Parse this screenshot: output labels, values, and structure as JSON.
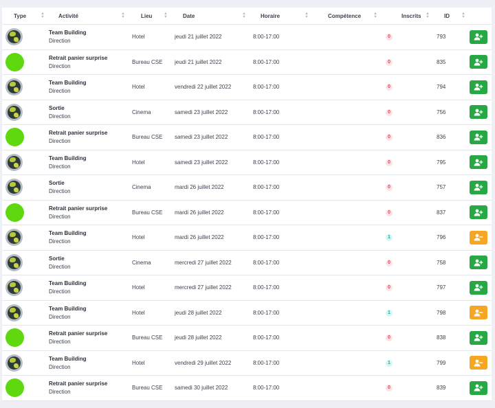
{
  "headers": {
    "type": "Type",
    "activite": "Activité",
    "lieu": "Lieu",
    "date": "Date",
    "horaire": "Horaire",
    "competence": "Compétence",
    "inscrits": "Inscrits",
    "id": "ID"
  },
  "colors": {
    "add_button": "#28a745",
    "remove_button": "#f5a623",
    "dot": "#5fd80f"
  },
  "rows": [
    {
      "type": "globe",
      "title": "Team Building",
      "sub": "Direction",
      "lieu": "Hotel",
      "date": "jeudi 21 juillet 2022",
      "horaire": "8:00-17:00",
      "competence": "",
      "inscrits": "0",
      "id": "793",
      "action": "add"
    },
    {
      "type": "dot",
      "title": "Retrait panier surprise",
      "sub": "Direction",
      "lieu": "Bureau CSE",
      "date": "jeudi 21 juillet 2022",
      "horaire": "8:00-17:00",
      "competence": "",
      "inscrits": "0",
      "id": "835",
      "action": "add"
    },
    {
      "type": "globe",
      "title": "Team Building",
      "sub": "Direction",
      "lieu": "Hotel",
      "date": "vendredi 22 juillet 2022",
      "horaire": "8:00-17:00",
      "competence": "",
      "inscrits": "0",
      "id": "794",
      "action": "add"
    },
    {
      "type": "globe",
      "title": "Sortie",
      "sub": "Direction",
      "lieu": "Cinema",
      "date": "samedi 23 juillet 2022",
      "horaire": "8:00-17:00",
      "competence": "",
      "inscrits": "0",
      "id": "756",
      "action": "add"
    },
    {
      "type": "dot",
      "title": "Retrait panier surprise",
      "sub": "Direction",
      "lieu": "Bureau CSE",
      "date": "samedi 23 juillet 2022",
      "horaire": "8:00-17:00",
      "competence": "",
      "inscrits": "0",
      "id": "836",
      "action": "add"
    },
    {
      "type": "globe",
      "title": "Team Building",
      "sub": "Direction",
      "lieu": "Hotel",
      "date": "samedi 23 juillet 2022",
      "horaire": "8:00-17:00",
      "competence": "",
      "inscrits": "0",
      "id": "795",
      "action": "add"
    },
    {
      "type": "globe",
      "title": "Sortie",
      "sub": "Direction",
      "lieu": "Cinema",
      "date": "mardi 26 juillet 2022",
      "horaire": "8:00-17:00",
      "competence": "",
      "inscrits": "0",
      "id": "757",
      "action": "add"
    },
    {
      "type": "dot",
      "title": "Retrait panier surprise",
      "sub": "Direction",
      "lieu": "Bureau CSE",
      "date": "mardi 26 juillet 2022",
      "horaire": "8:00-17:00",
      "competence": "",
      "inscrits": "0",
      "id": "837",
      "action": "add"
    },
    {
      "type": "globe",
      "title": "Team Building",
      "sub": "Direction",
      "lieu": "Hotel",
      "date": "mardi 26 juillet 2022",
      "horaire": "8:00-17:00",
      "competence": "",
      "inscrits": "1",
      "id": "796",
      "action": "remove"
    },
    {
      "type": "globe",
      "title": "Sortie",
      "sub": "Direction",
      "lieu": "Cinema",
      "date": "mercredi 27 juillet 2022",
      "horaire": "8:00-17:00",
      "competence": "",
      "inscrits": "0",
      "id": "758",
      "action": "add"
    },
    {
      "type": "globe",
      "title": "Team Building",
      "sub": "Direction",
      "lieu": "Hotel",
      "date": "mercredi 27 juillet 2022",
      "horaire": "8:00-17:00",
      "competence": "",
      "inscrits": "0",
      "id": "797",
      "action": "add"
    },
    {
      "type": "globe",
      "title": "Team Building",
      "sub": "Direction",
      "lieu": "Hotel",
      "date": "jeudi 28 juillet 2022",
      "horaire": "8:00-17:00",
      "competence": "",
      "inscrits": "1",
      "id": "798",
      "action": "remove"
    },
    {
      "type": "dot",
      "title": "Retrait panier surprise",
      "sub": "Direction",
      "lieu": "Bureau CSE",
      "date": "jeudi 28 juillet 2022",
      "horaire": "8:00-17:00",
      "competence": "",
      "inscrits": "0",
      "id": "838",
      "action": "add"
    },
    {
      "type": "globe",
      "title": "Team Building",
      "sub": "Direction",
      "lieu": "Hotel",
      "date": "vendredi 29 juillet 2022",
      "horaire": "8:00-17:00",
      "competence": "",
      "inscrits": "1",
      "id": "799",
      "action": "remove"
    },
    {
      "type": "dot",
      "title": "Retrait panier surprise",
      "sub": "Direction",
      "lieu": "Bureau CSE",
      "date": "samedi 30 juillet 2022",
      "horaire": "8:00-17:00",
      "competence": "",
      "inscrits": "0",
      "id": "839",
      "action": "add"
    }
  ]
}
